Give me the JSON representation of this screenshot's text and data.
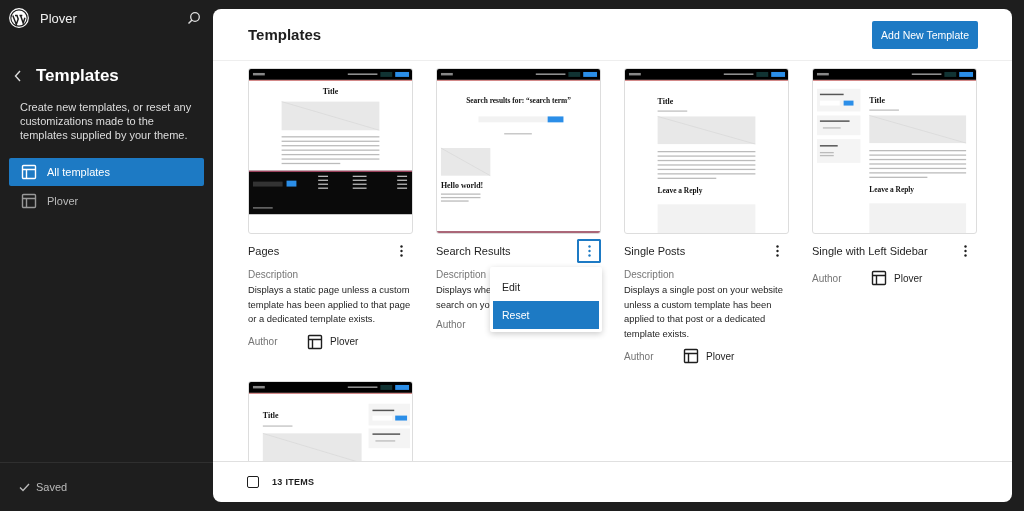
{
  "site": {
    "name": "Plover"
  },
  "sidebar": {
    "title": "Templates",
    "description": "Create new templates, or reset any customizations made to the templates supplied by your theme.",
    "items": [
      {
        "label": "All templates",
        "selected": true
      },
      {
        "label": "Plover",
        "selected": false
      }
    ],
    "status": "Saved"
  },
  "main": {
    "title": "Templates",
    "add_button": "Add New Template"
  },
  "templates": [
    {
      "name": "Pages",
      "description_label": "Description",
      "description_lines": [
        "Displays a static page unless a custom",
        "template has been applied to that page",
        "or a dedicated template exists."
      ],
      "author_label": "Author",
      "author": "Plover",
      "menu_open": false,
      "preview": {
        "kind": "page",
        "heading": "Title"
      }
    },
    {
      "name": "Search Results",
      "description_label": "Description",
      "description_lines": [
        "Displays whe",
        "search on yo"
      ],
      "author_label": "Author",
      "menu_open": true,
      "menu": [
        {
          "label": "Edit",
          "selected": false
        },
        {
          "label": "Reset",
          "selected": true
        }
      ],
      "preview": {
        "kind": "search",
        "heading": "Search results for: “search term”",
        "post_title": "Hello world!"
      }
    },
    {
      "name": "Single Posts",
      "description_label": "Description",
      "description_lines": [
        "Displays a single post on your website",
        "unless a custom template has been",
        "applied to that post or a dedicated",
        "template exists."
      ],
      "author_label": "Author",
      "author": "Plover",
      "menu_open": false,
      "preview": {
        "kind": "single",
        "heading": "Title",
        "reply_heading": "Leave a Reply"
      }
    },
    {
      "name": "Single with Left Sidebar",
      "author_label": "Author",
      "author": "Plover",
      "menu_open": false,
      "preview": {
        "kind": "sidebar",
        "heading": "Title",
        "reply_heading": "Leave a Reply"
      }
    },
    {
      "preview": {
        "kind": "sidebar-right",
        "heading": "Title"
      }
    }
  ],
  "footer": {
    "checked": false,
    "count": "13 ITEMS"
  }
}
